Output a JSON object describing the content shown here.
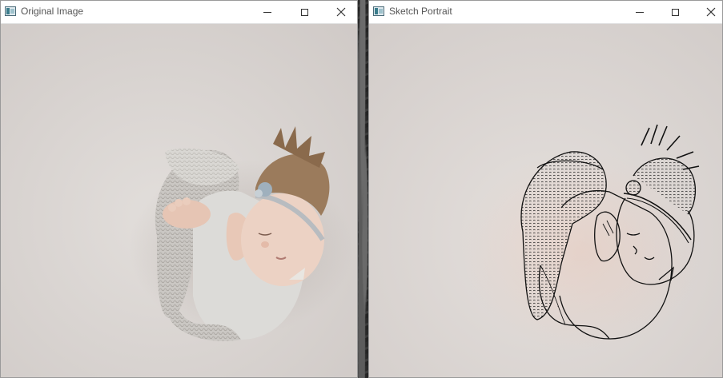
{
  "windows": {
    "original": {
      "title": "Original Image",
      "controls": {
        "minimize": "minimize",
        "maximize": "maximize",
        "close": "close"
      },
      "image_label": "newborn baby photo"
    },
    "sketch": {
      "title": "Sketch Portrait",
      "controls": {
        "minimize": "minimize",
        "maximize": "maximize",
        "close": "close"
      },
      "image_label": "pencil sketch of newborn baby"
    }
  },
  "colors": {
    "photo_background": "#d9d4d1",
    "sketch_background": "#dcd7d4",
    "hair": "#8a6a4c",
    "skin": "#e7c9b9",
    "knit": "#c9c6c2",
    "ink": "#111111"
  }
}
